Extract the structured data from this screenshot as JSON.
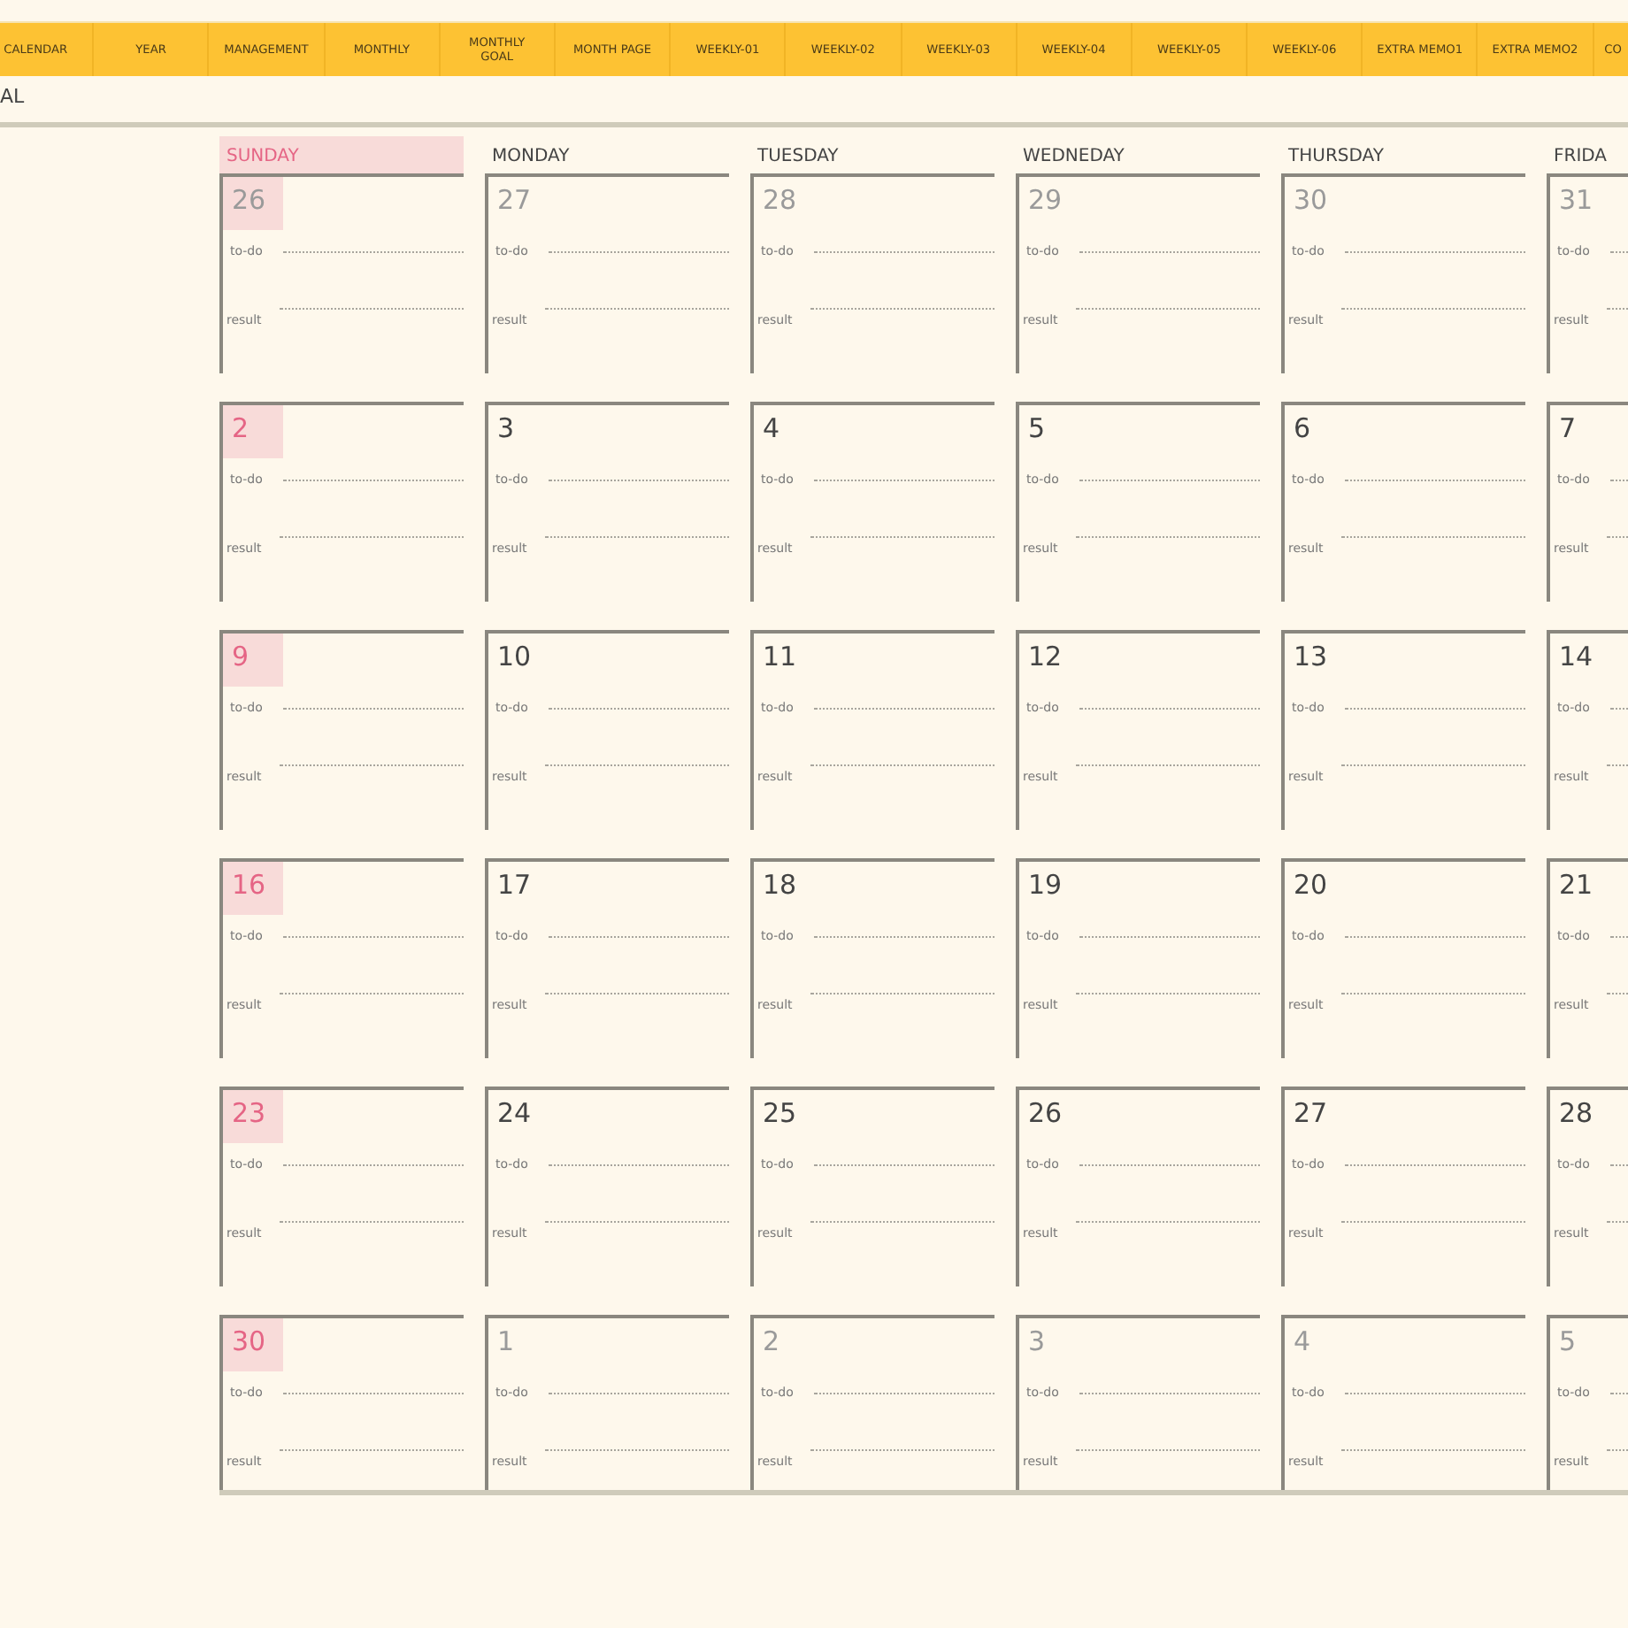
{
  "tabs": [
    {
      "label": "CALENDAR"
    },
    {
      "label": "YEAR"
    },
    {
      "label": "MANAGEMENT"
    },
    {
      "label": "MONTHLY"
    },
    {
      "label": "MONTHLY GOAL"
    },
    {
      "label": "MONTH PAGE"
    },
    {
      "label": "WEEKLY-01"
    },
    {
      "label": "WEEKLY-02"
    },
    {
      "label": "WEEKLY-03"
    },
    {
      "label": "WEEKLY-04"
    },
    {
      "label": "WEEKLY-05"
    },
    {
      "label": "WEEKLY-06"
    },
    {
      "label": "EXTRA MEMO1"
    },
    {
      "label": "EXTRA MEMO2"
    },
    {
      "label": "CO"
    }
  ],
  "page_title": "AL",
  "weekdays": [
    {
      "label": "SUNDAY",
      "kind": "sunday"
    },
    {
      "label": "MONDAY",
      "kind": "weekday"
    },
    {
      "label": "TUESDAY",
      "kind": "weekday"
    },
    {
      "label": "WEDNEDAY",
      "kind": "weekday"
    },
    {
      "label": "THURSDAY",
      "kind": "weekday"
    },
    {
      "label": "FRIDA",
      "kind": "weekday"
    }
  ],
  "weeks": [
    [
      {
        "date": "26",
        "in_month": false,
        "todo_label": "to-do",
        "result_label": "result"
      },
      {
        "date": "27",
        "in_month": false,
        "todo_label": "to-do",
        "result_label": "result"
      },
      {
        "date": "28",
        "in_month": false,
        "todo_label": "to-do",
        "result_label": "result"
      },
      {
        "date": "29",
        "in_month": false,
        "todo_label": "to-do",
        "result_label": "result"
      },
      {
        "date": "30",
        "in_month": false,
        "todo_label": "to-do",
        "result_label": "result"
      },
      {
        "date": "31",
        "in_month": false,
        "todo_label": "to-do",
        "result_label": "result"
      }
    ],
    [
      {
        "date": "2",
        "in_month": true,
        "todo_label": "to-do",
        "result_label": "result"
      },
      {
        "date": "3",
        "in_month": true,
        "todo_label": "to-do",
        "result_label": "result"
      },
      {
        "date": "4",
        "in_month": true,
        "todo_label": "to-do",
        "result_label": "result"
      },
      {
        "date": "5",
        "in_month": true,
        "todo_label": "to-do",
        "result_label": "result"
      },
      {
        "date": "6",
        "in_month": true,
        "todo_label": "to-do",
        "result_label": "result"
      },
      {
        "date": "7",
        "in_month": true,
        "todo_label": "to-do",
        "result_label": "result"
      }
    ],
    [
      {
        "date": "9",
        "in_month": true,
        "todo_label": "to-do",
        "result_label": "result"
      },
      {
        "date": "10",
        "in_month": true,
        "todo_label": "to-do",
        "result_label": "result"
      },
      {
        "date": "11",
        "in_month": true,
        "todo_label": "to-do",
        "result_label": "result"
      },
      {
        "date": "12",
        "in_month": true,
        "todo_label": "to-do",
        "result_label": "result"
      },
      {
        "date": "13",
        "in_month": true,
        "todo_label": "to-do",
        "result_label": "result"
      },
      {
        "date": "14",
        "in_month": true,
        "todo_label": "to-do",
        "result_label": "result"
      }
    ],
    [
      {
        "date": "16",
        "in_month": true,
        "todo_label": "to-do",
        "result_label": "result"
      },
      {
        "date": "17",
        "in_month": true,
        "todo_label": "to-do",
        "result_label": "result"
      },
      {
        "date": "18",
        "in_month": true,
        "todo_label": "to-do",
        "result_label": "result"
      },
      {
        "date": "19",
        "in_month": true,
        "todo_label": "to-do",
        "result_label": "result"
      },
      {
        "date": "20",
        "in_month": true,
        "todo_label": "to-do",
        "result_label": "result"
      },
      {
        "date": "21",
        "in_month": true,
        "todo_label": "to-do",
        "result_label": "result"
      }
    ],
    [
      {
        "date": "23",
        "in_month": true,
        "todo_label": "to-do",
        "result_label": "result"
      },
      {
        "date": "24",
        "in_month": true,
        "todo_label": "to-do",
        "result_label": "result"
      },
      {
        "date": "25",
        "in_month": true,
        "todo_label": "to-do",
        "result_label": "result"
      },
      {
        "date": "26",
        "in_month": true,
        "todo_label": "to-do",
        "result_label": "result"
      },
      {
        "date": "27",
        "in_month": true,
        "todo_label": "to-do",
        "result_label": "result"
      },
      {
        "date": "28",
        "in_month": true,
        "todo_label": "to-do",
        "result_label": "result"
      }
    ],
    [
      {
        "date": "30",
        "in_month": true,
        "todo_label": "to-do",
        "result_label": "result"
      },
      {
        "date": "1",
        "in_month": false,
        "todo_label": "to-do",
        "result_label": "result"
      },
      {
        "date": "2",
        "in_month": false,
        "todo_label": "to-do",
        "result_label": "result"
      },
      {
        "date": "3",
        "in_month": false,
        "todo_label": "to-do",
        "result_label": "result"
      },
      {
        "date": "4",
        "in_month": false,
        "todo_label": "to-do",
        "result_label": "result"
      },
      {
        "date": "5",
        "in_month": false,
        "todo_label": "to-do",
        "result_label": "result"
      }
    ]
  ]
}
